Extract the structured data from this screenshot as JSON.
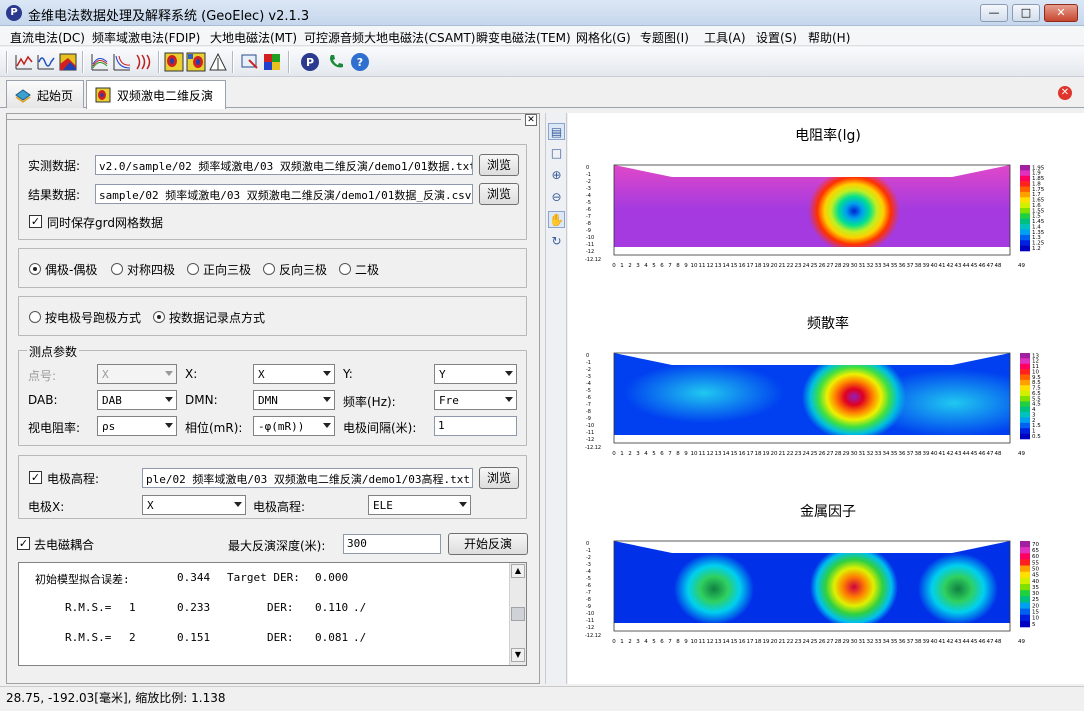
{
  "window": {
    "title": "金维电法数据处理及解释系统 (GeoElec)  v2.1.3",
    "app_icon": "P"
  },
  "menu": [
    "直流电法(DC)",
    "频率域激电法(FDIP)",
    "大地电磁法(MT)",
    "可控源音频大地电磁法(CSAMT)",
    "瞬变电磁法(TEM)",
    "网格化(G)",
    "专题图(I)",
    "工具(A)",
    "设置(S)",
    "帮助(H)"
  ],
  "toolbar_icons": [
    "line-chart-icon",
    "wave-chart-icon",
    "layer-color-icon",
    "multi-line-icon",
    "curve-icon",
    "profile-icon",
    "section-map-icon",
    "section-map-2-icon",
    "triangle-icon",
    "export-icon",
    "color-grid-icon",
    "logo-p-icon",
    "phone-icon",
    "help-icon"
  ],
  "tabs": [
    {
      "label": "起始页",
      "icon": "start-page-icon"
    },
    {
      "label": "双频激电二维反演",
      "icon": "inversion-icon"
    }
  ],
  "files": {
    "measured_label": "实测数据:",
    "measured_path": "v2.0/sample/02 频率域激电/03 双频激电二维反演/demo1/01数据.txt",
    "result_label": "结果数据:",
    "result_path": "sample/02 频率域激电/03 双频激电二维反演/demo1/01数据_反演.csv",
    "browse": "浏览",
    "save_grd": "同时保存grd网格数据"
  },
  "array_types": [
    "偶极-偶极",
    "对称四极",
    "正向三极",
    "反向三极",
    "二极"
  ],
  "record_modes": [
    "按电极号跑极方式",
    "按数据记录点方式"
  ],
  "params": {
    "title": "测点参数",
    "point_label": "点号:",
    "point_value": "X",
    "x_label": "X:",
    "x_value": "X",
    "y_label": "Y:",
    "y_value": "Y",
    "dab_label": "DAB:",
    "dab_value": "DAB",
    "dmn_label": "DMN:",
    "dmn_value": "DMN",
    "freq_label": "频率(Hz):",
    "freq_value": "Fre",
    "rho_label": "视电阻率:",
    "rho_value": "ρs",
    "phase_label": "相位(mR):",
    "phase_value": "-φ(mR))",
    "spacing_label": "电极间隔(米):",
    "spacing_value": "1"
  },
  "elevation": {
    "label": "电极高程:",
    "path": "ple/02 频率域激电/03 双频激电二维反演/demo1/03高程.txt",
    "browse": "浏览",
    "x_label": "电极X:",
    "x_value": "X",
    "elev_label": "电极高程:",
    "elev_value": "ELE"
  },
  "inversion": {
    "remove_em": "去电磁耦合",
    "max_depth_label": "最大反演深度(米):",
    "max_depth_value": "300",
    "start": "开始反演"
  },
  "log": [
    {
      "c1": "初始模型拟合误差:",
      "c2": "",
      "c3": "0.344",
      "c4": "Target DER:",
      "c5": "0.000",
      "c6": ""
    },
    {
      "c1": "R.M.S.=",
      "c2": "1",
      "c3": "0.233",
      "c4": "DER:",
      "c5": "0.110",
      "c6": "./"
    },
    {
      "c1": "R.M.S.=",
      "c2": "2",
      "c3": "0.151",
      "c4": "DER:",
      "c5": "0.081",
      "c6": "./"
    }
  ],
  "panels": [
    {
      "title": "电阻率(lg)",
      "legend": [
        "1.95",
        "1.9",
        "1.85",
        "1.8",
        "1.75",
        "1.7",
        "1.65",
        "1.6",
        "1.55",
        "1.5",
        "1.45",
        "1.4",
        "1.35",
        "1.3",
        "1.25",
        "1.2"
      ]
    },
    {
      "title": "频散率",
      "legend": [
        "13",
        "12",
        "11",
        "10",
        "9.5",
        "8.5",
        "7.5",
        "6.5",
        "5.5",
        "4.5",
        "4",
        "3",
        "2",
        "1.5",
        "1",
        "0.5"
      ]
    },
    {
      "title": "金属因子",
      "legend": [
        "70",
        "65",
        "60",
        "55",
        "50",
        "45",
        "40",
        "35",
        "30",
        "25",
        "20",
        "15",
        "10",
        "5"
      ]
    }
  ],
  "axis": {
    "y_ticks": [
      "0",
      "-1",
      "-2",
      "-3",
      "-4",
      "-5",
      "-6",
      "-7",
      "-8",
      "-9",
      "-10",
      "-11",
      "-12"
    ],
    "y_end": "-12.12",
    "x_ticks": [
      "0",
      "1",
      "2",
      "3",
      "4",
      "5",
      "6",
      "7",
      "8",
      "9",
      "10",
      "11",
      "12",
      "13",
      "14",
      "15",
      "16",
      "17",
      "18",
      "19",
      "20",
      "21",
      "22",
      "23",
      "24",
      "25",
      "26",
      "27",
      "28",
      "29",
      "30",
      "31",
      "32",
      "33",
      "34",
      "35",
      "36",
      "37",
      "38",
      "39",
      "40",
      "41",
      "42",
      "43",
      "44",
      "45",
      "46",
      "47",
      "48"
    ],
    "x_end": "49"
  },
  "status": "28.75, -192.03[毫米], 缩放比例: 1.138",
  "colors": {
    "title_bar": "#c6d7ec",
    "close_red": "#e0352b",
    "accent_blue": "#2b3a8f"
  }
}
